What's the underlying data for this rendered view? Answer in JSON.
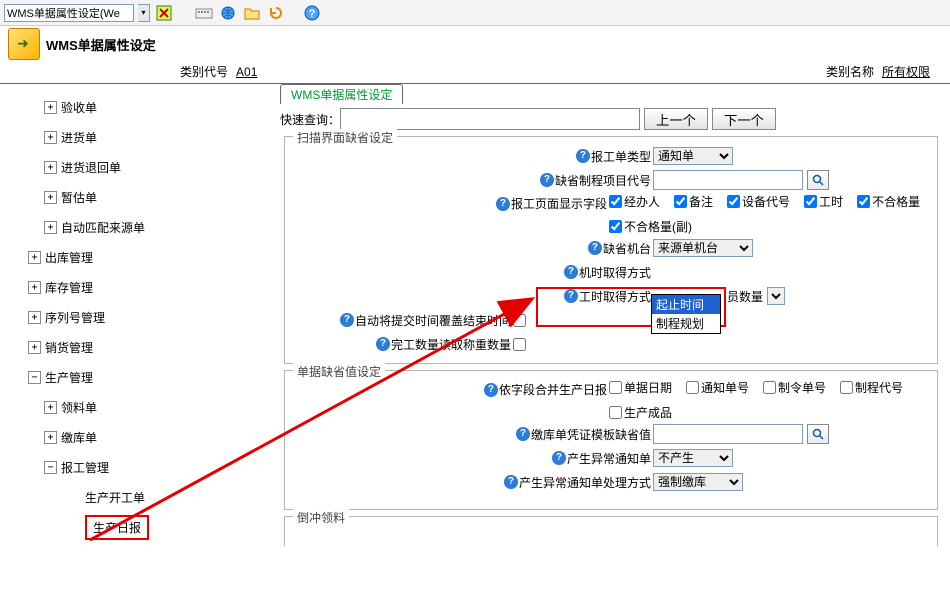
{
  "toolbar": {
    "combo_value": "WMS单据属性设定(We"
  },
  "header": {
    "title": "WMS单据属性设定"
  },
  "category": {
    "code_label": "类别代号",
    "code_value": "A01",
    "name_label": "类别名称",
    "name_value": "所有权限"
  },
  "tab": {
    "label": "WMS单据属性设定"
  },
  "search": {
    "label": "快速查询：",
    "value": "",
    "prev": "上一个",
    "next": "下一个"
  },
  "tree": [
    {
      "indent": 24,
      "toggle": "+",
      "label": "验收单"
    },
    {
      "indent": 24,
      "toggle": "+",
      "label": "进货单"
    },
    {
      "indent": 24,
      "toggle": "+",
      "label": "进货退回单"
    },
    {
      "indent": 24,
      "toggle": "+",
      "label": "暂估单"
    },
    {
      "indent": 24,
      "toggle": "+",
      "label": "自动匹配来源单"
    },
    {
      "indent": 8,
      "toggle": "+",
      "label": "出库管理"
    },
    {
      "indent": 8,
      "toggle": "+",
      "label": "库存管理"
    },
    {
      "indent": 8,
      "toggle": "+",
      "label": "序列号管理"
    },
    {
      "indent": 8,
      "toggle": "+",
      "label": "销货管理"
    },
    {
      "indent": 8,
      "toggle": "−",
      "label": "生产管理"
    },
    {
      "indent": 24,
      "toggle": "+",
      "label": "领料单"
    },
    {
      "indent": 24,
      "toggle": "+",
      "label": "缴库单"
    },
    {
      "indent": 24,
      "toggle": "−",
      "label": "报工管理"
    },
    {
      "indent": 48,
      "toggle": "",
      "label": "生产开工单"
    },
    {
      "indent": 48,
      "toggle": "",
      "label": "生产日报",
      "selected": true
    }
  ],
  "scan_defaults": {
    "legend": "扫描界面缺省设定",
    "report_type_label": "报工单类型",
    "report_type_value": "通知单",
    "project_code_label": "缺省制程项目代号",
    "project_code_value": "",
    "display_fields_label": "报工页面显示字段",
    "display_fields": [
      {
        "label": "经办人",
        "checked": true
      },
      {
        "label": "备注",
        "checked": true
      },
      {
        "label": "设备代号",
        "checked": true
      },
      {
        "label": "工时",
        "checked": true
      },
      {
        "label": "不合格量",
        "checked": true
      },
      {
        "label": "不合格量(副)",
        "checked": true
      }
    ],
    "default_machine_label": "缺省机台",
    "default_machine_value": "来源单机台",
    "machine_method_label": "机时取得方式",
    "labor_method_label": "工时取得方式",
    "labor_method_suffix": "员数量",
    "dropdown_options": [
      "起止时间",
      "制程规划"
    ],
    "auto_commit_label": "自动将提交时间覆盖结束时间",
    "auto_commit_checked": false,
    "completed_qty_label": "完工数量读取称重数量",
    "completed_qty_checked": false
  },
  "doc_defaults": {
    "legend": "单据缺省值设定",
    "merge_label": "依字段合并生产日报",
    "merge_fields": [
      {
        "label": "单据日期",
        "checked": false
      },
      {
        "label": "通知单号",
        "checked": false
      },
      {
        "label": "制令单号",
        "checked": false
      },
      {
        "label": "制程代号",
        "checked": false
      },
      {
        "label": "生产成品",
        "checked": false
      }
    ],
    "voucher_template_label": "缴库单凭证模板缺省值",
    "voucher_template_value": "",
    "gen_exception_label": "产生异常通知单",
    "gen_exception_value": "不产生",
    "exception_handle_label": "产生异常通知单处理方式",
    "exception_handle_value": "强制缴库"
  },
  "reverse": {
    "legend": "倒冲领料"
  }
}
